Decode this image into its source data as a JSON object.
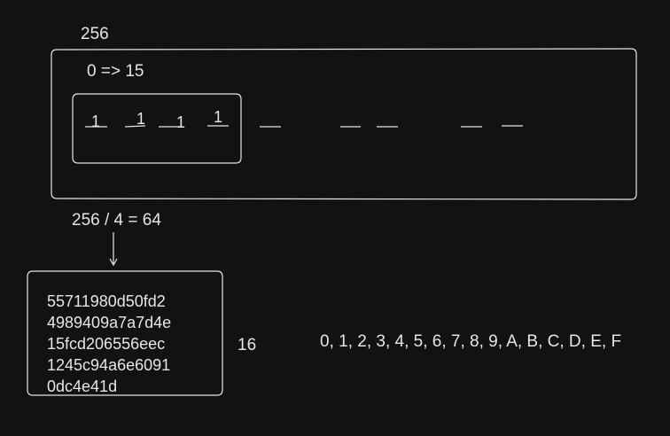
{
  "top_label": "256",
  "range_label": "0 => 15",
  "bits": [
    "1",
    "1",
    "1",
    "1"
  ],
  "division_label": "256 / 4 = 64",
  "hash_lines": [
    "55711980d50fd2",
    "4989409a7a7d4e",
    "15fcd206556eec",
    "1245c94a6e6091",
    "0dc4e41d"
  ],
  "count_label": "16",
  "hex_digits": "0, 1, 2, 3, 4, 5, 6, 7, 8, 9, A, B, C, D, E, F",
  "colors": {
    "background": "#121212",
    "stroke": "#e6e6e6"
  }
}
